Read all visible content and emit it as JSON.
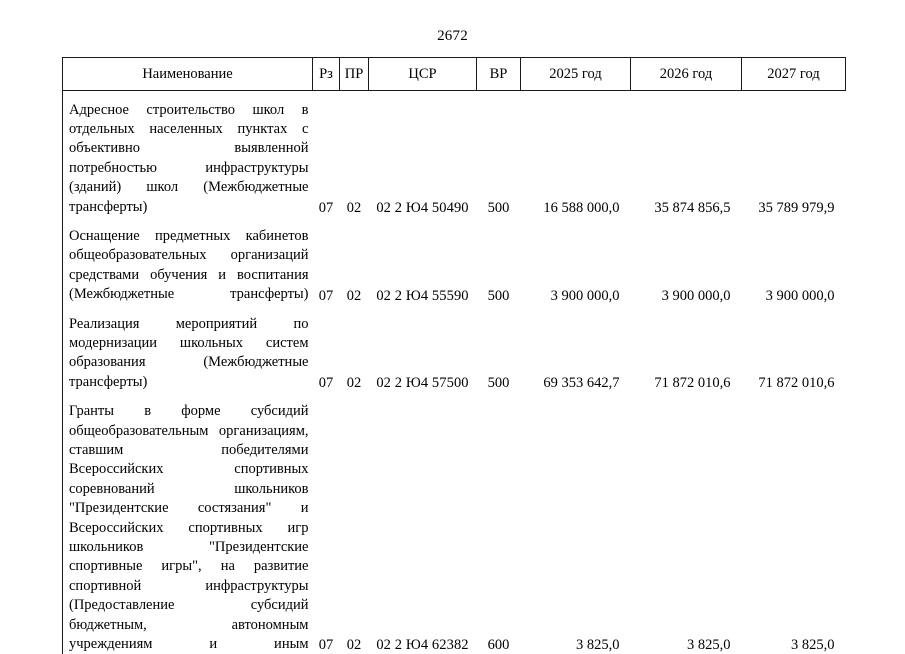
{
  "page": {
    "number": "2672"
  },
  "table": {
    "headers": [
      {
        "key": "name",
        "label": "Наименование"
      },
      {
        "key": "rz",
        "label": "Рз"
      },
      {
        "key": "pr",
        "label": "ПР"
      },
      {
        "key": "csr",
        "label": "ЦСР"
      },
      {
        "key": "vr",
        "label": "ВР"
      },
      {
        "key": "y2025",
        "label": "2025 год"
      },
      {
        "key": "y2026",
        "label": "2026 год"
      },
      {
        "key": "y2027",
        "label": "2027 год"
      }
    ],
    "rows": [
      {
        "name": "Адресное строительство школ в отдельных населенных пунктах с объективно выявленной потребностью инфраструктуры (зданий) школ (Межбюджетные трансферты)",
        "name_lines": [
          "Адресное строительство школ в",
          "отдельных населенных пунктах с",
          "объективно выявленной",
          "потребностью инфраструктуры",
          "(зданий) школ (Межбюджетные",
          "трансферты)"
        ],
        "rz": "07",
        "pr": "02",
        "csr": "02 2 Ю4 50490",
        "vr": "500",
        "y2025": "16 588 000,0",
        "y2026": "35 874 856,5",
        "y2027": "35 789 979,9"
      },
      {
        "name": "Оснащение предметных кабинетов общеобразовательных организаций средствами обучения и воспитания (Межбюджетные трансферты)",
        "name_lines": [
          "Оснащение предметных кабинетов",
          "общеобразовательных организаций",
          "средствами обучения и воспитания",
          "(Межбюджетные трансферты)"
        ],
        "rz": "07",
        "pr": "02",
        "csr": "02 2 Ю4 55590",
        "vr": "500",
        "y2025": "3 900 000,0",
        "y2026": "3 900 000,0",
        "y2027": "3 900 000,0"
      },
      {
        "name": "Реализация мероприятий по модернизации школьных систем образования (Межбюджетные трансферты)",
        "name_lines": [
          "Реализация мероприятий по",
          "модернизации школьных систем",
          "образования (Межбюджетные",
          "трансферты)"
        ],
        "rz": "07",
        "pr": "02",
        "csr": "02 2 Ю4 57500",
        "vr": "500",
        "y2025": "69 353 642,7",
        "y2026": "71 872 010,6",
        "y2027": "71 872 010,6"
      },
      {
        "name": "Гранты в форме субсидий общеобразовательным организациям, ставшим победителями Всероссийских спортивных соревнований школьников \"Президентские состязания\" и Всероссийских спортивных игр школьников \"Президентские спортивные игры\", на развитие спортивной инфраструктуры (Предоставление субсидий бюджетным, автономным учреждениям и иным",
        "name_lines": [
          "Гранты в форме субсидий",
          "общеобразовательным организациям,",
          "ставшим победителями",
          "Всероссийских спортивных",
          "соревнований школьников",
          "\"Президентские состязания\" и",
          "Всероссийских спортивных игр",
          "школьников \"Президентские",
          "спортивные игры\", на развитие",
          "спортивной инфраструктуры",
          "(Предоставление субсидий",
          "бюджетным, автономным",
          "учреждениям и иным"
        ],
        "rz": "07",
        "pr": "02",
        "csr": "02 2 Ю4 62382",
        "vr": "600",
        "y2025": "3 825,0",
        "y2026": "3 825,0",
        "y2027": "3 825,0"
      }
    ]
  }
}
